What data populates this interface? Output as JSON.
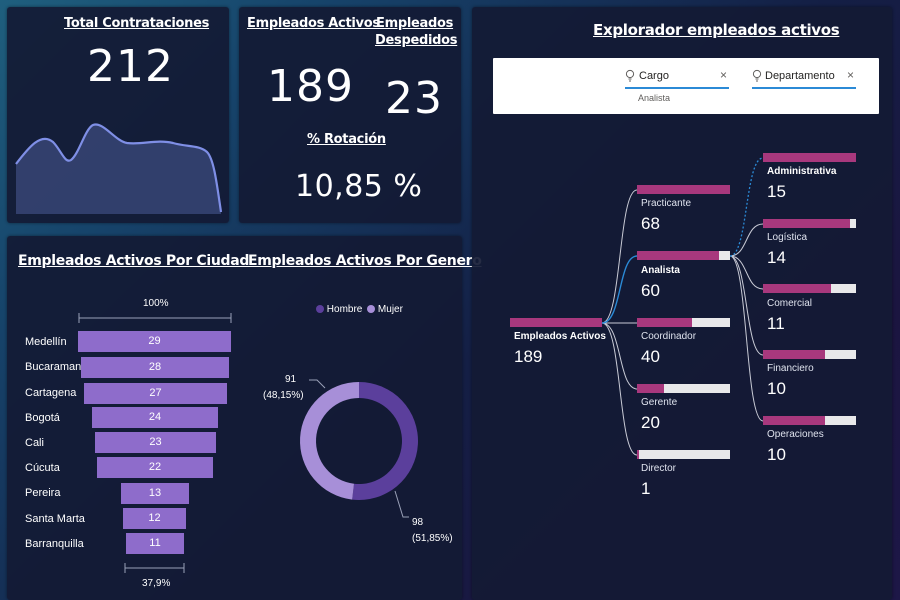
{
  "kpi_contrataciones": {
    "title": "Total Contrataciones",
    "value": "212"
  },
  "kpi_activos": {
    "title": "Empleados Activos",
    "value": "189"
  },
  "kpi_despedidos": {
    "title": "Empleados Despedidos",
    "title_line1": "Empleados",
    "title_line2": "Despedidos",
    "value": "23"
  },
  "kpi_rotacion": {
    "title": "% Rotación",
    "value": "10,85 %"
  },
  "ciudad": {
    "title": "Empleados Activos Por Ciudad",
    "top_label": "100%",
    "bottom_label": "37,9%",
    "rows": [
      {
        "name": "Medellín",
        "value": "29"
      },
      {
        "name": "Bucaramanga",
        "value": "28"
      },
      {
        "name": "Cartagena",
        "value": "27"
      },
      {
        "name": "Bogotá",
        "value": "24"
      },
      {
        "name": "Cali",
        "value": "23"
      },
      {
        "name": "Cúcuta",
        "value": "22"
      },
      {
        "name": "Pereira",
        "value": "13"
      },
      {
        "name": "Santa Marta",
        "value": "12"
      },
      {
        "name": "Barranquilla",
        "value": "11"
      }
    ]
  },
  "genero": {
    "title": "Empleados Activos Por Genero",
    "legend": [
      {
        "name": "Hombre",
        "color": "#5b3f9c"
      },
      {
        "name": "Mujer",
        "color": "#a78fd8"
      }
    ],
    "mujer_count": "91",
    "mujer_pct": "(48,15%)",
    "hombre_count": "98",
    "hombre_pct": "(51,85%)"
  },
  "chart_data": {
    "type": "pie",
    "categories": [
      "Hombre",
      "Mujer"
    ],
    "values": [
      98,
      91
    ],
    "title": "Empleados Activos Por Genero"
  },
  "explorer": {
    "title": "Explorador empleados activos",
    "filters": {
      "cargo_label": "Cargo",
      "cargo_value": "Analista",
      "depto_label": "Departamento",
      "close_glyph": "×"
    },
    "root": {
      "label": "Empleados Activos",
      "value": "189"
    },
    "cargos": [
      {
        "label": "Practicante",
        "value": "68",
        "fraction": 1.0
      },
      {
        "label": "Analista",
        "value": "60",
        "fraction": 0.88
      },
      {
        "label": "Coordinador",
        "value": "40",
        "fraction": 0.59
      },
      {
        "label": "Gerente",
        "value": "20",
        "fraction": 0.29
      },
      {
        "label": "Director",
        "value": "1",
        "fraction": 0.015
      }
    ],
    "departamentos": [
      {
        "label": "Administrativa",
        "value": "15",
        "fraction": 1.0
      },
      {
        "label": "Logística",
        "value": "14",
        "fraction": 0.93
      },
      {
        "label": "Comercial",
        "value": "11",
        "fraction": 0.73
      },
      {
        "label": "Financiero",
        "value": "10",
        "fraction": 0.67
      },
      {
        "label": "Operaciones",
        "value": "10",
        "fraction": 0.67
      }
    ]
  },
  "colors": {
    "bar_purple": "#8e6ccb",
    "decomp_fill": "#a8387d",
    "decomp_track": "#e8e8ea",
    "hombre": "#5b3f9c",
    "mujer": "#a78fd8",
    "accent_blue": "#2b8ad6"
  }
}
